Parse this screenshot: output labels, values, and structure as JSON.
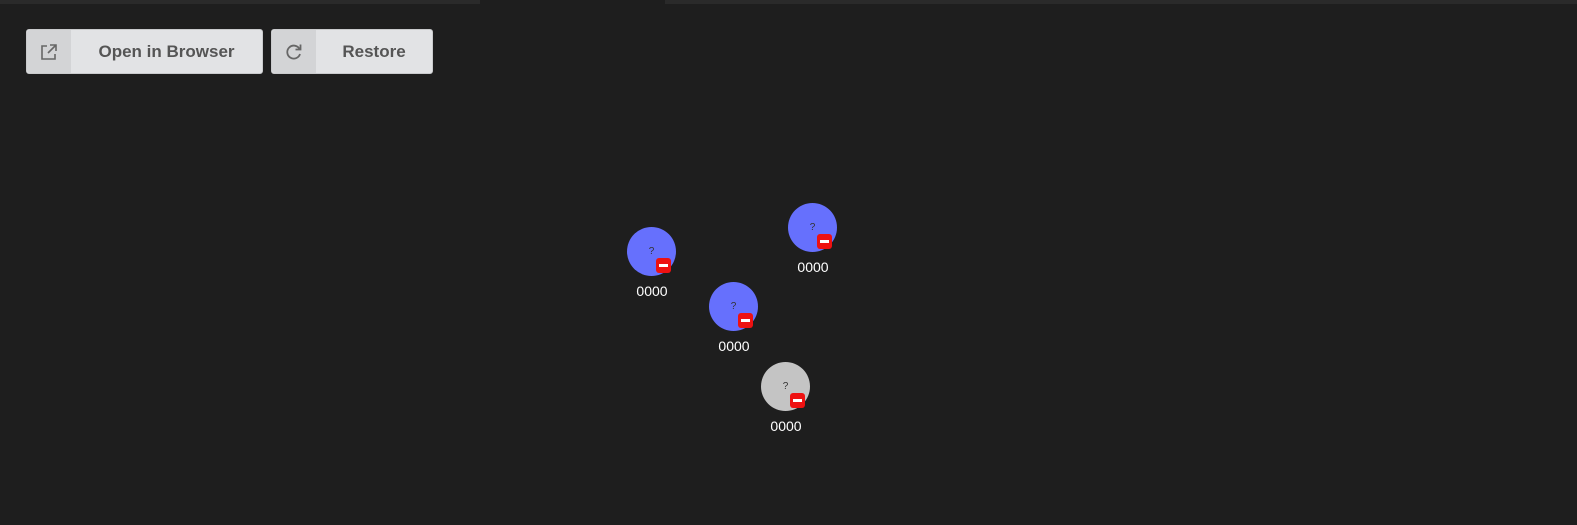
{
  "toolbar": {
    "open_label": "Open in Browser",
    "open_icon": "external-link-icon",
    "restore_label": "Restore",
    "restore_icon": "refresh-icon"
  },
  "colors": {
    "background": "#1e1e1e",
    "node_blue": "#6670fd",
    "node_gray": "#c4c4c4",
    "badge_red": "#ee1111"
  },
  "nodes": [
    {
      "label": "0000",
      "glyph": "?",
      "color": "#6670fd"
    },
    {
      "label": "0000",
      "glyph": "?",
      "color": "#6670fd"
    },
    {
      "label": "0000",
      "glyph": "?",
      "color": "#6670fd"
    },
    {
      "label": "0000",
      "glyph": "?",
      "color": "#c4c4c4"
    }
  ]
}
